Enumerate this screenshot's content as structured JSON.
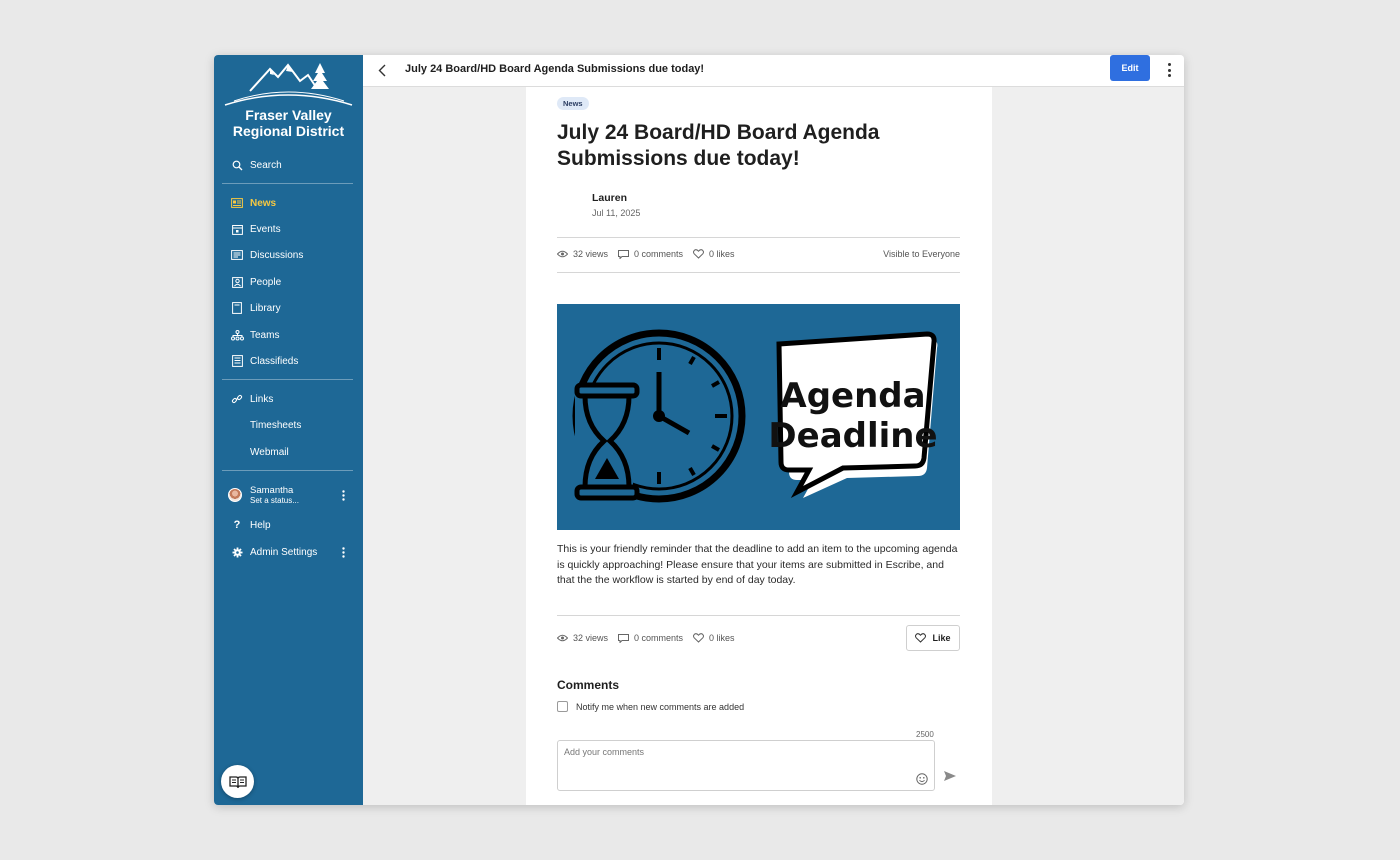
{
  "sidebar": {
    "logo": {
      "line1": "Fraser Valley",
      "line2": "Regional District"
    },
    "search_label": "Search",
    "nav": [
      {
        "label": "News",
        "icon": "news-icon",
        "active": true
      },
      {
        "label": "Events",
        "icon": "calendar-icon",
        "active": false
      },
      {
        "label": "Discussions",
        "icon": "discussion-icon",
        "active": false
      },
      {
        "label": "People",
        "icon": "people-icon",
        "active": false
      },
      {
        "label": "Library",
        "icon": "library-icon",
        "active": false
      },
      {
        "label": "Teams",
        "icon": "teams-icon",
        "active": false
      },
      {
        "label": "Classifieds",
        "icon": "classifieds-icon",
        "active": false
      }
    ],
    "links": [
      {
        "label": "Links",
        "icon": "link-icon"
      },
      {
        "label": "Timesheets",
        "icon": ""
      },
      {
        "label": "Webmail",
        "icon": ""
      }
    ],
    "user": {
      "name": "Samantha",
      "status": "Set a status..."
    },
    "help_label": "Help",
    "admin_label": "Admin Settings",
    "accent_color": "#1e6896",
    "active_color": "#f5c842"
  },
  "topbar": {
    "title": "July 24 Board/HD Board Agenda Submissions due today!",
    "edit_label": "Edit"
  },
  "article": {
    "tag": "News",
    "title": "July 24 Board/HD Board Agenda Submissions due today!",
    "author": "Lauren",
    "date": "Jul 11, 2025",
    "views": "32 views",
    "comments": "0 comments",
    "likes": "0 likes",
    "visibility": "Visible to Everyone",
    "hero_text_line1": "Agenda",
    "hero_text_line2": "Deadline",
    "body": "This is your friendly reminder that the deadline to add an item to the upcoming agenda is quickly approaching! Please ensure that your items are submitted in Escribe, and that the the workflow is started by end of day today.",
    "like_label": "Like"
  },
  "comments": {
    "title": "Comments",
    "notify_label": "Notify me when new comments are added",
    "counter": "2500",
    "placeholder": "Add your comments"
  }
}
